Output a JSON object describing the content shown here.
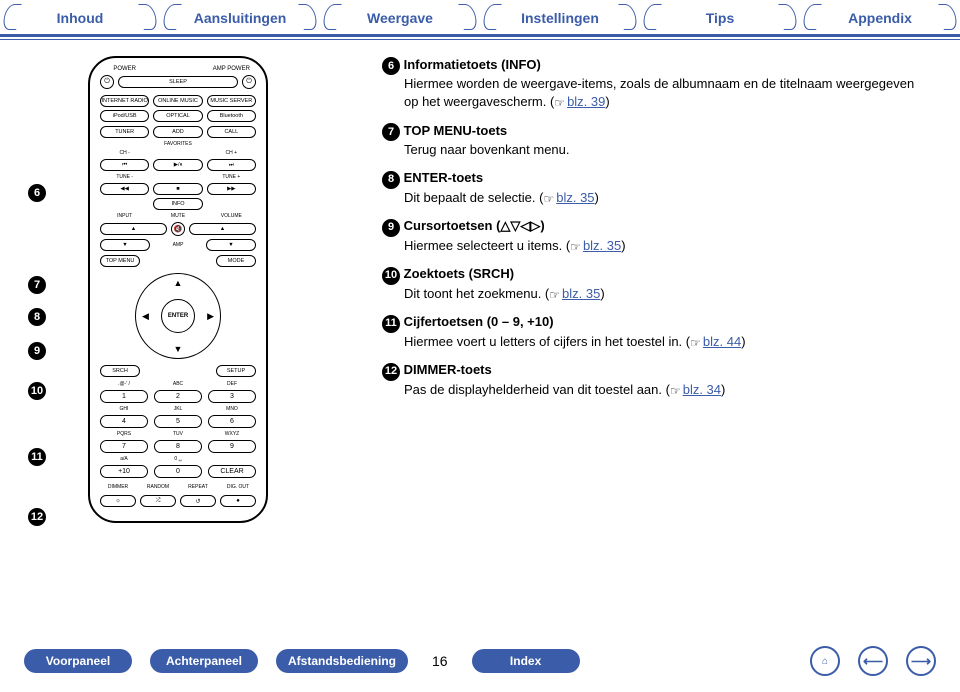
{
  "tabs": {
    "t1": "Inhoud",
    "t2": "Aansluitingen",
    "t3": "Weergave",
    "t4": "Instellingen",
    "t5": "Tips",
    "t6": "Appendix"
  },
  "items": {
    "i6": {
      "n": "6",
      "title": "Informatietoets (INFO)",
      "desc": "Hiermee worden de weergave-items, zoals de albumnaam en de titelnaam weergegeven op het weergavescherm. (",
      "ref": "blz. 39",
      "tail": ")"
    },
    "i7": {
      "n": "7",
      "title": "TOP MENU-toets",
      "desc": "Terug naar bovenkant menu."
    },
    "i8": {
      "n": "8",
      "title": "ENTER-toets",
      "desc": "Dit bepaalt de selectie. (",
      "ref": "blz. 35",
      "tail": ")"
    },
    "i9": {
      "n": "9",
      "title": "Cursortoetsen (△▽◁▷)",
      "desc": "Hiermee selecteert u items. (",
      "ref": "blz. 35",
      "tail": ")"
    },
    "i10": {
      "n": "10",
      "title": "Zoektoets (SRCH)",
      "desc": "Dit toont het zoekmenu. (",
      "ref": "blz. 35",
      "tail": ")"
    },
    "i11": {
      "n": "11",
      "title": "Cijfertoetsen (0 – 9, +10)",
      "desc": "Hiermee voert u letters of cijfers in het toestel in. (",
      "ref": "blz. 44",
      "tail": ")"
    },
    "i12": {
      "n": "12",
      "title": "DIMMER-toets",
      "desc": "Pas de displayhelderheid van dit toestel aan. (",
      "ref": "blz. 34",
      "tail": ")"
    }
  },
  "bottom": {
    "b1": "Voorpaneel",
    "b2": "Achterpaneel",
    "b3": "Afstandsbediening",
    "page": "16",
    "b4": "Index"
  },
  "callout_nums": {
    "c6": "6",
    "c7": "7",
    "c8": "8",
    "c9": "9",
    "c10": "10",
    "c11": "11",
    "c12": "12"
  },
  "remote": {
    "power": "POWER",
    "amp_power": "AMP POWER",
    "sleep": "SLEEP",
    "src": {
      "a": "INTERNET RADIO",
      "b": "ONLINE MUSIC",
      "c": "MUSIC SERVER",
      "d": "iPod/USB",
      "e": "OPTICAL",
      "f": "Bluetooth"
    },
    "tuner": "TUNER",
    "add": "ADD",
    "call": "CALL",
    "fav": "FAVORITES",
    "chm": "CH -",
    "chp": "CH +",
    "tunem": "TUNE -",
    "tunep": "TUNE +",
    "info": "INFO",
    "input": "INPUT",
    "volume": "VOLUME",
    "mute": "MUTE",
    "amp": "AMP",
    "topmenu": "TOP MENU",
    "mode": "MODE",
    "enter": "ENTER",
    "srch": "SRCH",
    "setup": "SETUP",
    "keys": {
      "l1": ".@-' /",
      "l2": "ABC",
      "l3": "DEF",
      "l4": "GHI",
      "l5": "JKL",
      "l6": "MNO",
      "l7": "PQRS",
      "l8": "TUV",
      "l9": "WXYZ",
      "l10": "a/A",
      "l11": "0 ␣",
      "l12": "",
      "k1": "1",
      "k2": "2",
      "k3": "3",
      "k4": "4",
      "k5": "5",
      "k6": "6",
      "k7": "7",
      "k8": "8",
      "k9": "9",
      "k10": "+10",
      "k11": "0",
      "k12": "CLEAR"
    },
    "bot": {
      "dimmer": "DIMMER",
      "random": "RANDOM",
      "repeat": "REPEAT",
      "digout": "DIG. OUT"
    }
  }
}
